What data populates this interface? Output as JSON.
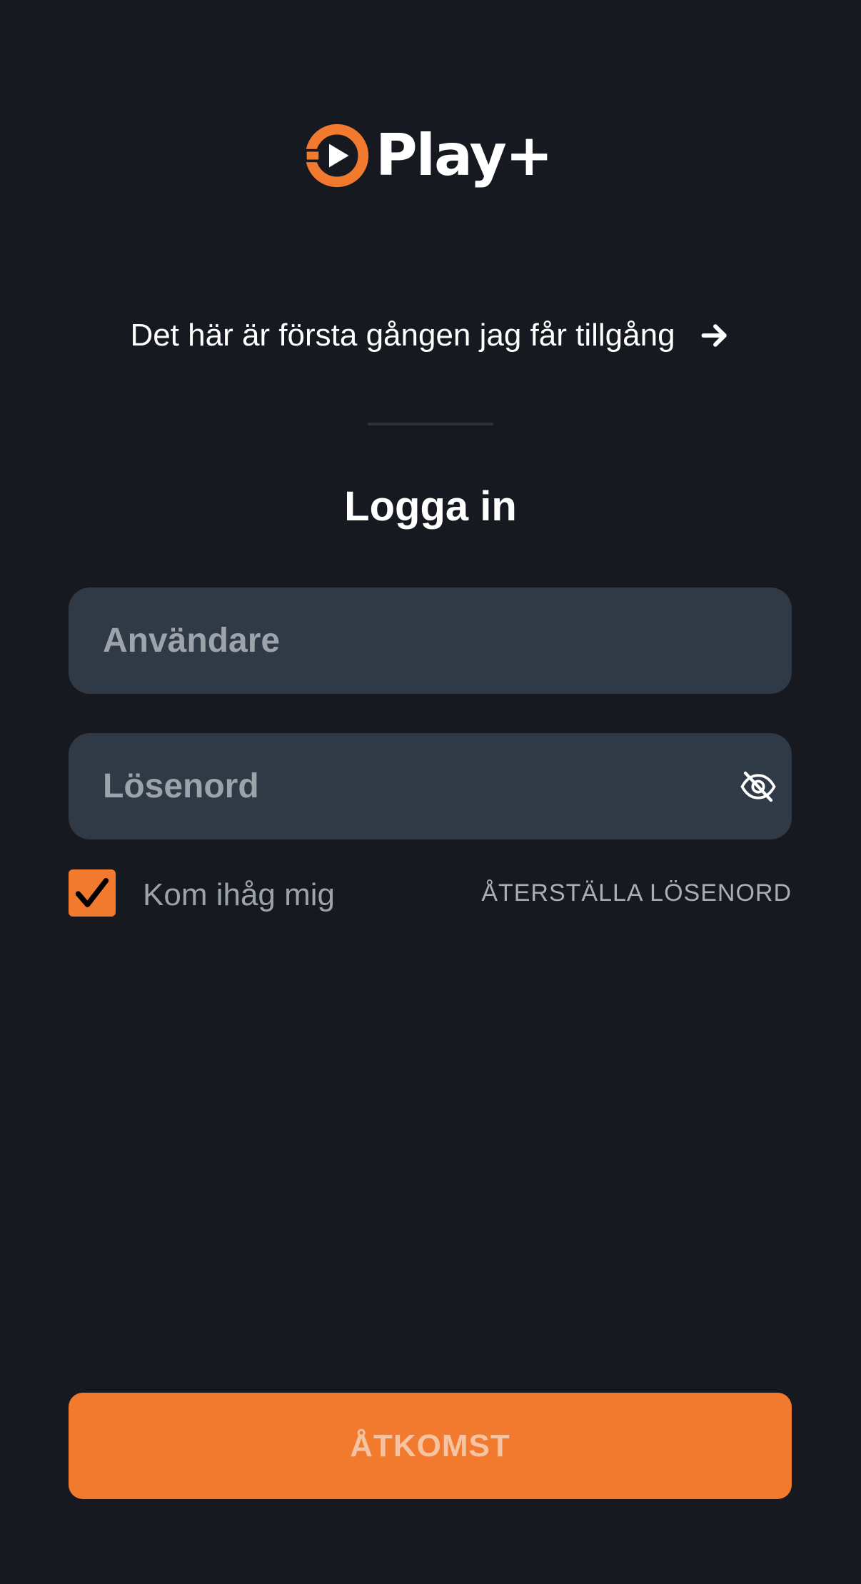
{
  "brand": {
    "name": "Play+",
    "accent_color": "#f27a2e",
    "logo_icon": "play-circle-icon"
  },
  "onboarding": {
    "first_time_label": "Det här är första gången jag får tillgång",
    "arrow_icon": "arrow-right-icon"
  },
  "login": {
    "title": "Logga in",
    "username": {
      "placeholder": "Användare",
      "value": ""
    },
    "password": {
      "placeholder": "Lösenord",
      "value": "",
      "toggle_icon": "eye-off-icon"
    },
    "remember_me": {
      "label": "Kom ihåg mig",
      "checked": true,
      "icon": "checkmark-icon"
    },
    "reset_password_label": "ÅTERSTÄLLA LÖSENORD",
    "submit_label": "ÅTKOMST"
  },
  "colors": {
    "background": "#161920",
    "field_background": "#303a47",
    "placeholder": "#9da3ab",
    "accent": "#f27a2e",
    "button_text": "#f6c3a3"
  }
}
